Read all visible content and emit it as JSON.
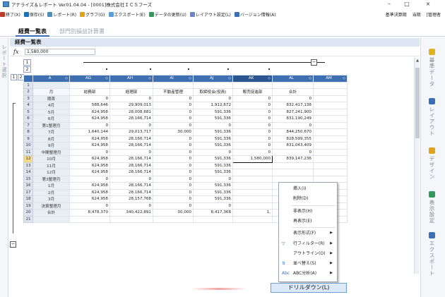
{
  "window": {
    "title": "アナライズ＆レポート Ver01.04.04 - [0001]株式会社ＩＣＳフーズ",
    "min_icon": "minimize-icon",
    "max_icon": "maximize-icon",
    "close_icon": "close-icon",
    "min_glyph": "–",
    "max_glyph": "□",
    "close_glyph": "×"
  },
  "menu": {
    "items": [
      {
        "label": "終了(X)",
        "icon": "exit-icon",
        "color": "#c0392b"
      },
      {
        "label": "保存(S)",
        "icon": "save-icon",
        "color": "#1f6fb5"
      },
      {
        "label": "レポート(R)",
        "icon": "report-icon",
        "color": "#4a90c2"
      },
      {
        "label": "グラフ(G)",
        "icon": "graph-icon",
        "color": "#e2a21c"
      },
      {
        "label": "エクスポート(E)",
        "icon": "export-icon",
        "color": "#5aa0d6"
      },
      {
        "label": "データの更新(U)",
        "icon": "refresh-icon",
        "color": "#2e9a5c"
      },
      {
        "label": "レイアウト設定(L)",
        "icon": "layout-icon",
        "color": "#6a86c9"
      },
      {
        "label": "バージョン情報(A)",
        "icon": "info-icon",
        "color": "#3a6fb5"
      }
    ],
    "right_basis": "基準決算期",
    "right_period": "当期",
    "right_user": "[管理者"
  },
  "tabs": {
    "active": "経費一覧表",
    "inactive": "部門別損益計算書"
  },
  "left_panel_label": "レポート選択",
  "sheet": {
    "title": "経費一覧表",
    "fx_label": "fx",
    "fx_value": "1,580,000",
    "outline_levels": [
      "1",
      "2"
    ],
    "outline_rows": [
      "1",
      "2"
    ],
    "collapse_glyph": "−"
  },
  "grid": {
    "columns": [
      {
        "label": "A",
        "sort": "◇",
        "hl": false
      },
      {
        "label": "AG",
        "sort": "◇",
        "hl": false
      },
      {
        "label": "AH",
        "sort": "◇",
        "hl": false
      },
      {
        "label": "AI",
        "sort": "◇",
        "hl": false
      },
      {
        "label": "AJ",
        "sort": "◇",
        "hl": false
      },
      {
        "label": "AK",
        "sort": "◇",
        "hl": true
      },
      {
        "label": "AL",
        "sort": "◇",
        "hl": false
      },
      {
        "label": "AM",
        "sort": "◇",
        "hl": false
      }
    ],
    "rows": [
      {
        "n": "1",
        "cells": [
          "",
          "",
          "",
          "",
          "",
          "",
          "",
          ""
        ]
      },
      {
        "n": "2",
        "cells": [
          "月",
          "総務部",
          "経理部",
          "不動産管理",
          "取締役会(役員)",
          "販売促進部",
          "合計",
          ""
        ],
        "header": true
      },
      {
        "n": "3",
        "cells": [
          "期首",
          "0",
          "0",
          "0",
          "0",
          "0",
          "0",
          ""
        ]
      },
      {
        "n": "4",
        "cells": [
          "4月",
          "588,646",
          "29,909,013",
          "0",
          "1,912,672",
          "0",
          "832,417,138",
          ""
        ]
      },
      {
        "n": "5",
        "cells": [
          "5月",
          "624,958",
          "28,008,681",
          "0",
          "591,336",
          "0",
          "827,241,900",
          ""
        ]
      },
      {
        "n": "6",
        "cells": [
          "6月",
          "624,958",
          "28,166,714",
          "0",
          "591,336",
          "0",
          "831,190,249",
          ""
        ]
      },
      {
        "n": "7",
        "cells": [
          "第1整理月",
          "0",
          "0",
          "0",
          "0",
          "0",
          "0",
          ""
        ]
      },
      {
        "n": "8",
        "cells": [
          "7月",
          "1,640,144",
          "29,013,717",
          "30,000",
          "591,336",
          "0",
          "844,250,670",
          ""
        ]
      },
      {
        "n": "9",
        "cells": [
          "8月",
          "624,958",
          "28,166,714",
          "0",
          "591,336",
          "0",
          "828,599,355",
          ""
        ]
      },
      {
        "n": "10",
        "cells": [
          "9月",
          "624,958",
          "28,166,714",
          "0",
          "591,336",
          "0",
          "831,043,409",
          ""
        ]
      },
      {
        "n": "11",
        "cells": [
          "中間整理月",
          "0",
          "0",
          "0",
          "0",
          "0",
          "0",
          ""
        ]
      },
      {
        "n": "12",
        "cells": [
          "10月",
          "624,958",
          "28,166,714",
          "0",
          "591,336",
          "1,580,000",
          "839,147,236",
          ""
        ],
        "selected": true
      },
      {
        "n": "13",
        "cells": [
          "11月",
          "624,958",
          "28,166,714",
          "0",
          "591,336",
          "",
          "",
          ""
        ]
      },
      {
        "n": "14",
        "cells": [
          "12月",
          "624,958",
          "28,166,714",
          "0",
          "591,336",
          "",
          "",
          ""
        ]
      },
      {
        "n": "15",
        "cells": [
          "第3整理月",
          "0",
          "0",
          "0",
          "0",
          "",
          "",
          ""
        ]
      },
      {
        "n": "16",
        "cells": [
          "1月",
          "624,958",
          "28,166,714",
          "0",
          "591,336",
          "",
          "",
          ""
        ]
      },
      {
        "n": "17",
        "cells": [
          "2月",
          "624,958",
          "28,166,714",
          "0",
          "591,336",
          "",
          "",
          ""
        ]
      },
      {
        "n": "18",
        "cells": [
          "3月",
          "624,958",
          "28,157,768",
          "0",
          "591,336",
          "",
          "",
          ""
        ]
      },
      {
        "n": "19",
        "cells": [
          "決算整理月",
          "0",
          "0",
          "0",
          "0",
          "",
          "",
          ""
        ]
      },
      {
        "n": "20",
        "cells": [
          "合計",
          "8,478,370",
          "340,422,891",
          "30,000",
          "8,417,368",
          "1,",
          "",
          ""
        ]
      },
      {
        "n": "21",
        "cells": [
          "",
          "",
          "",
          "",
          "",
          "",
          "",
          ""
        ]
      }
    ]
  },
  "right_panel": [
    {
      "label": "基準データ",
      "icon": "database-icon",
      "color": "#e2b21c"
    },
    {
      "label": "レイアウト",
      "icon": "layout-panel-icon",
      "color": "#3a6fb5"
    },
    {
      "label": "デザイン",
      "icon": "design-icon",
      "color": "#e2a21c"
    },
    {
      "label": "表示設定",
      "icon": "display-settings-icon",
      "color": "#2e9a5c"
    },
    {
      "label": "エクスポート",
      "icon": "export-panel-icon",
      "color": "#3a6fb5"
    }
  ],
  "context_menu": {
    "items": [
      {
        "label": "挿入(I)",
        "arrow": false,
        "icon": ""
      },
      {
        "label": "削除(D)",
        "arrow": false,
        "icon": ""
      },
      {
        "label": "非表示(H)",
        "arrow": false,
        "icon": ""
      },
      {
        "label": "再表示(E)",
        "arrow": false,
        "icon": ""
      },
      {
        "label": "表示形式(F)",
        "arrow": true,
        "icon": ""
      },
      {
        "label": "行フィルター(R)",
        "arrow": true,
        "icon": "filter-icon",
        "glyph": "▽"
      },
      {
        "label": "アウトライン(O)",
        "arrow": true,
        "icon": ""
      },
      {
        "label": "並べ替え(S)",
        "arrow": true,
        "icon": "sort-icon",
        "glyph": "⇅"
      },
      {
        "label": "ABC分析(A)",
        "arrow": true,
        "icon": "abc-icon",
        "glyph": "Abc"
      }
    ],
    "arrow_glyph": "▶",
    "drilldown": "ドリルダウン(L)"
  }
}
